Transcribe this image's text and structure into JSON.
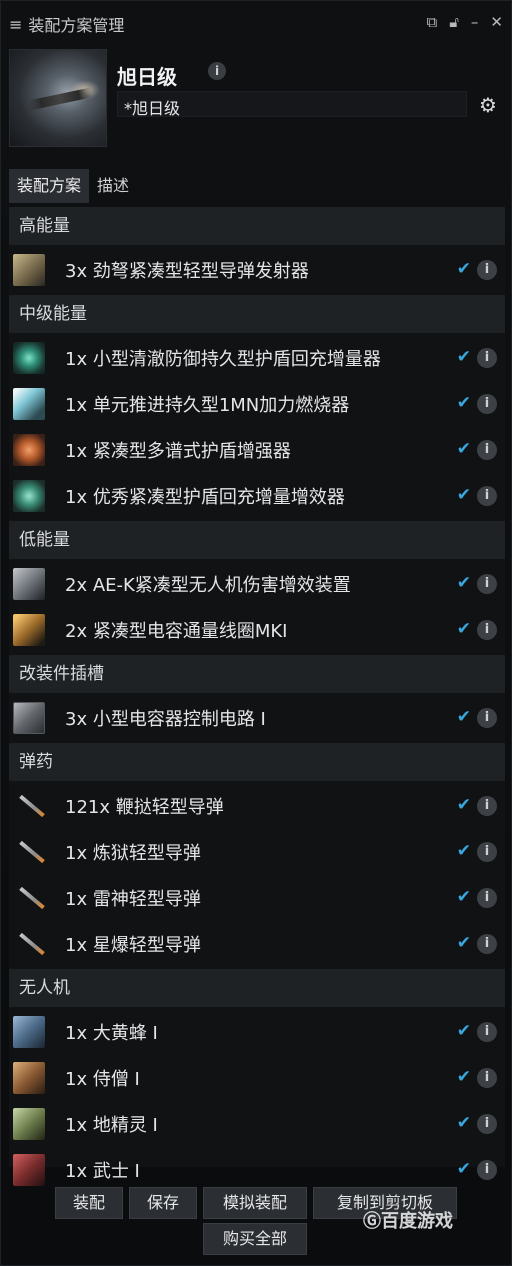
{
  "window": {
    "title": "装配方案管理"
  },
  "header": {
    "ship_name": "旭日级",
    "fit_name": "*旭日级"
  },
  "tabs": [
    "装配方案",
    "描述"
  ],
  "sections": [
    {
      "title": "高能量",
      "items": [
        {
          "label": "3x 劲弩紧凑型轻型导弹发射器",
          "icon": "launcher-icon"
        }
      ]
    },
    {
      "title": "中级能量",
      "items": [
        {
          "label": "1x 小型清澈防御持久型护盾回充增量器",
          "icon": "shield-booster-icon"
        },
        {
          "label": "1x 单元推进持久型1MN加力燃烧器",
          "icon": "afterburner-icon"
        },
        {
          "label": "1x 紧凑型多谱式护盾增强器",
          "icon": "shield-hardener-icon"
        },
        {
          "label": "1x 优秀紧凑型护盾回充增量增效器",
          "icon": "boost-amplifier-icon"
        }
      ]
    },
    {
      "title": "低能量",
      "items": [
        {
          "label": "2x AE-K紧凑型无人机伤害增效装置",
          "icon": "drone-damage-icon"
        },
        {
          "label": "2x 紧凑型电容通量线圈MKI",
          "icon": "capacitor-coil-icon"
        }
      ]
    },
    {
      "title": "改装件插槽",
      "items": [
        {
          "label": "3x 小型电容器控制电路 I",
          "icon": "rig-icon"
        }
      ]
    },
    {
      "title": "弹药",
      "items": [
        {
          "label": "121x 鞭挞轻型导弹",
          "icon": "missile-icon"
        },
        {
          "label": "1x 炼狱轻型导弹",
          "icon": "missile-icon"
        },
        {
          "label": "1x 雷神轻型导弹",
          "icon": "missile-icon"
        },
        {
          "label": "1x 星爆轻型导弹",
          "icon": "missile-icon"
        }
      ]
    },
    {
      "title": "无人机",
      "items": [
        {
          "label": "1x 大黄蜂 I",
          "icon": "drone-hornet-icon"
        },
        {
          "label": "1x 侍僧 I",
          "icon": "drone-acolyte-icon"
        },
        {
          "label": "1x 地精灵 I",
          "icon": "drone-hobgoblin-icon"
        },
        {
          "label": "1x 武士 I",
          "icon": "drone-warrior-icon"
        }
      ]
    }
  ],
  "buttons": {
    "fit": "装配",
    "save": "保存",
    "simulate": "模拟装配",
    "copy": "复制到剪切板",
    "buy_all": "购买全部"
  },
  "watermark": "百度游戏",
  "colors": {
    "check": "#38a9e0",
    "section_bg": "#1f2225",
    "window_bg": "#0b0c0e"
  }
}
